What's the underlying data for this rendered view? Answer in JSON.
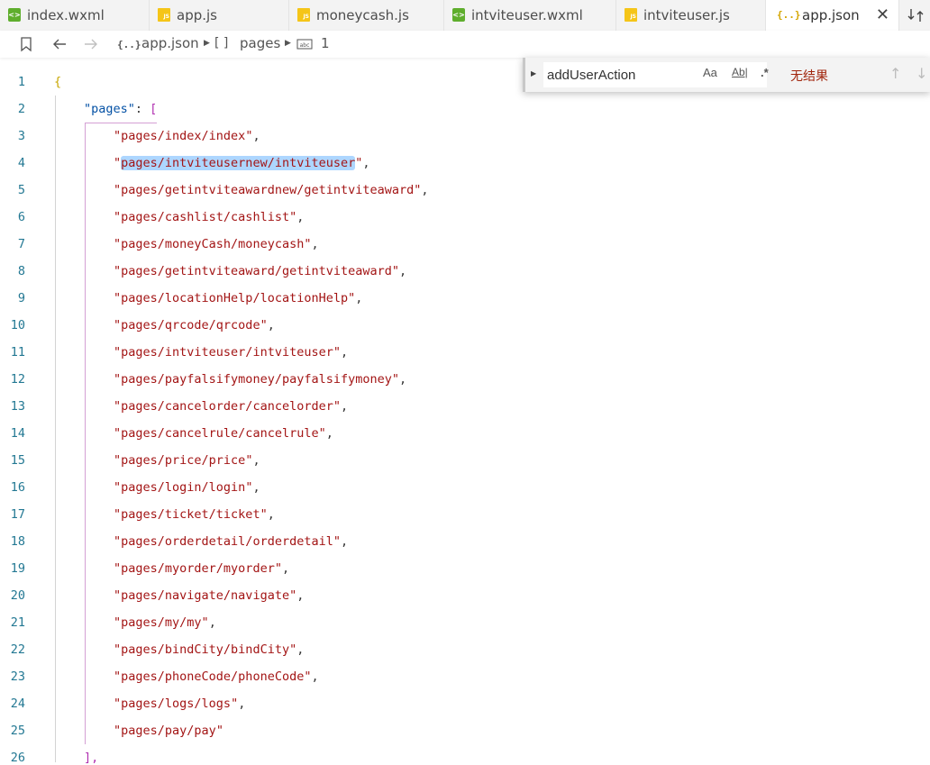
{
  "tabs": [
    {
      "label": "index.wxml",
      "icon": "wxml-file-icon",
      "active": false
    },
    {
      "label": "app.js",
      "icon": "js-file-icon",
      "active": false
    },
    {
      "label": "moneycash.js",
      "icon": "js-file-icon",
      "active": false
    },
    {
      "label": "intviteuser.wxml",
      "icon": "wxml-file-icon",
      "active": false
    },
    {
      "label": "intviteuser.js",
      "icon": "js-file-icon",
      "active": false
    },
    {
      "label": "app.json",
      "icon": "json-file-icon",
      "active": true
    }
  ],
  "tab_close_glyph": "✕",
  "breadcrumb": {
    "file": "app.json",
    "array_glyph": "[ ]",
    "key": "pages",
    "index": "1"
  },
  "find": {
    "value": "addUserAction",
    "match_case": "Aa",
    "whole_word": "Ab|",
    "regex": ".*",
    "result": "无结果"
  },
  "editor": {
    "open_brace": "{",
    "pages_key": "\"pages\"",
    "colon": ": ",
    "open_bracket": "[",
    "close_bracket": "],",
    "selected_text": "pages/intviteusernew/intviteuser",
    "entries": [
      "pages/index/index",
      "pages/intviteusernew/intviteuser",
      "pages/getintviteawardnew/getintviteaward",
      "pages/cashlist/cashlist",
      "pages/moneyCash/moneycash",
      "pages/getintviteaward/getintviteaward",
      "pages/locationHelp/locationHelp",
      "pages/qrcode/qrcode",
      "pages/intviteuser/intviteuser",
      "pages/payfalsifymoney/payfalsifymoney",
      "pages/cancelorder/cancelorder",
      "pages/cancelrule/cancelrule",
      "pages/price/price",
      "pages/login/login",
      "pages/ticket/ticket",
      "pages/orderdetail/orderdetail",
      "pages/myorder/myorder",
      "pages/navigate/navigate",
      "pages/my/my",
      "pages/bindCity/bindCity",
      "pages/phoneCode/phoneCode",
      "pages/logs/logs",
      "pages/pay/pay"
    ]
  },
  "colors": {
    "string": "#a31515",
    "key": "#0451a5",
    "line_number": "#237893",
    "selection": "#add6ff",
    "no_result": "#a1260d"
  }
}
